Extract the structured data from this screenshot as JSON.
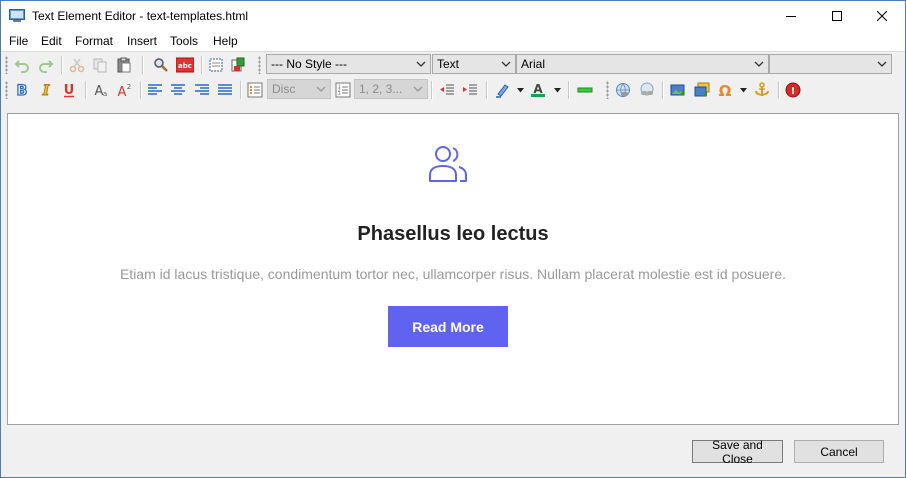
{
  "window": {
    "title": "Text Element Editor - text-templates.html",
    "accent_color": "#4a7dbd"
  },
  "menu": [
    "File",
    "Edit",
    "Format",
    "Insert",
    "Tools",
    "Help"
  ],
  "toolbar": {
    "style_select": "--- No Style ---",
    "type_select": "Text",
    "font_select": "Arial",
    "size_select": "",
    "bullet_select": "Disc",
    "number_select": "1, 2, 3...",
    "icons": [
      "undo-icon",
      "redo-icon",
      "cut-icon",
      "copy-icon",
      "paste-icon",
      "find-icon",
      "spellcheck-icon",
      "select-all-icon",
      "paste-special-icon",
      "bold-icon",
      "italic-icon",
      "underline-icon",
      "font-size-icon",
      "superscript-icon",
      "align-left-icon",
      "align-center-icon",
      "align-right-icon",
      "justify-icon",
      "bullet-list-icon",
      "numbered-list-icon",
      "outdent-icon",
      "indent-icon",
      "highlight-icon",
      "font-color-icon",
      "horizontal-rule-icon",
      "link-icon",
      "unlink-icon",
      "image-icon",
      "gallery-icon",
      "special-char-icon",
      "anchor-icon",
      "info-icon"
    ]
  },
  "content": {
    "icon": "users-icon",
    "headline": "Phasellus leo lectus",
    "body": "Etiam id lacus tristique, condimentum tortor nec, ullamcorper risus. Nullam placerat molestie est id posuere.",
    "button_label": "Read More",
    "button_color": "#6063f0"
  },
  "footer": {
    "save_label": "Save and Close",
    "cancel_label": "Cancel"
  }
}
